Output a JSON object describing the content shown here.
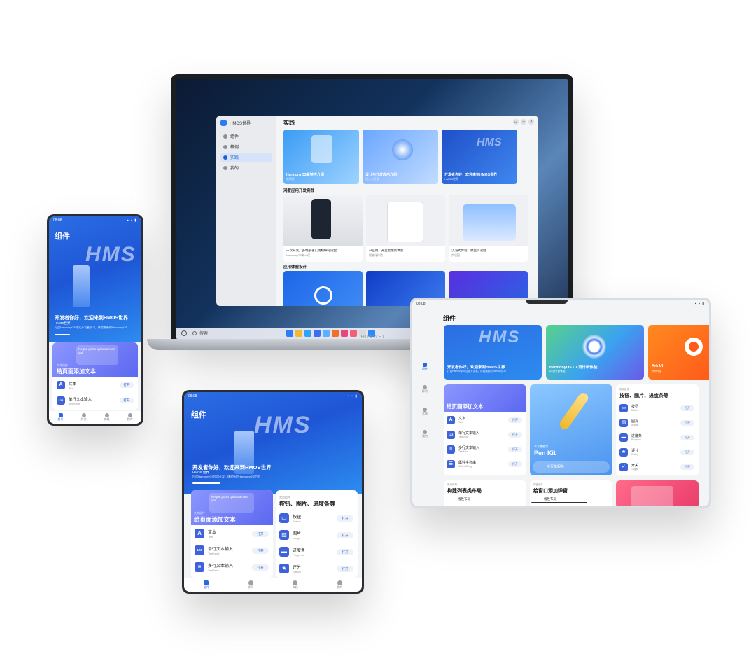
{
  "laptop": {
    "brand": "HUAWEI",
    "window": {
      "app_name": "HMOS世界",
      "nav": [
        {
          "label": "组件",
          "active": false
        },
        {
          "label": "样例",
          "active": false
        },
        {
          "label": "实践",
          "active": true
        },
        {
          "label": "我的",
          "active": false
        }
      ],
      "title": "实践",
      "controls": [
        "↔",
        "–",
        "×"
      ],
      "hero_cards": [
        {
          "title": "HarmonyOS新特性介绍",
          "subtitle": "新特性",
          "color_a": "#3a9cf5",
          "color_b": "#9fd3ff"
        },
        {
          "title": "设计与开发应用介绍",
          "subtitle": "设计与开发",
          "color_a": "#4b8bf7",
          "color_b": "#a9cbff"
        },
        {
          "title": "开发者你好，欢迎来到HMOS世界",
          "subtitle": "HMOS世界",
          "color_a": "#1f4fc9",
          "color_b": "#3f88f0"
        }
      ],
      "section1": "鸿蒙应用开发实践",
      "practice_cards": [
        {
          "title": "一次开发，多端部署实现精细化适配",
          "sub": "HarmonyOS新一代"
        },
        {
          "title": "AI应用，开启智能新体验",
          "sub": "智能化体验"
        },
        {
          "title": "沉浸式体验，原生实况窗",
          "sub": "实况窗"
        }
      ],
      "section2": "应用体验设计",
      "taskbar_search": "搜索"
    }
  },
  "phone": {
    "time": "08:08",
    "signals": "▪ ▪ ▮",
    "page_title": "组件",
    "hero_title": "开发者你好，欢迎来到HMOS世界",
    "hero_sub": "HMOS世界",
    "hero_desc": "打造HarmonyOS样式开发者学习，体验最新的HarmonyOS",
    "hms": "HMS",
    "card_tag": "文本组件",
    "card_title": "给页面添加文本",
    "card_lorem": "Neque porro quisquam est qui",
    "items": [
      {
        "icon": "A",
        "name": "文本",
        "en": "Text",
        "btn": "打开"
      },
      {
        "icon": "123",
        "name": "单行文本输入",
        "en": "TextInput",
        "btn": "打开"
      }
    ],
    "nav": [
      "组件",
      "样例",
      "实践",
      "我的"
    ]
  },
  "foldable": {
    "time": "08:08",
    "page_title": "组件",
    "hero_title": "开发者你好，欢迎来到HMOS世界",
    "hero_sub": "HMOS 世界",
    "hero_desc": "打造HarmonyOS应用开发，体验新的HarmonyOS世界",
    "hms": "HMS",
    "left_card": {
      "tag": "文本组件",
      "title": "给页面添加文本",
      "lorem": "Neque porro quisquam est qui",
      "items": [
        {
          "icon": "A",
          "name": "文本",
          "en": "Text",
          "btn": "打开"
        },
        {
          "icon": "123",
          "name": "单行文本输入",
          "en": "TextInput",
          "btn": "打开"
        },
        {
          "icon": "≡",
          "name": "多行文本输入",
          "en": "TextArea",
          "btn": "打开"
        }
      ]
    },
    "right_card": {
      "tag": "常用组件",
      "title": "按钮、图片、进度条等",
      "items": [
        {
          "icon": "▭",
          "name": "按钮",
          "en": "Button",
          "btn": "打开"
        },
        {
          "icon": "▨",
          "name": "图片",
          "en": "Image",
          "btn": "打开"
        },
        {
          "icon": "▬",
          "name": "进度条",
          "en": "Progress",
          "btn": "打开"
        },
        {
          "icon": "★",
          "name": "评分",
          "en": "Rating",
          "btn": "打开"
        }
      ]
    },
    "nav": [
      "组件",
      "样例",
      "实践",
      "我的"
    ]
  },
  "tablet": {
    "time": "08:08",
    "page_title": "组件",
    "side_nav": [
      "组件",
      "样例",
      "实践",
      "我的"
    ],
    "banners": [
      {
        "title": "开发者你好，欢迎来到HMOS世界",
        "sub": "打造HarmonyOS应用开发者，体验最新的HarmonyOS"
      },
      {
        "title": "HarmonyOS UX设计新体验",
        "sub": "UX设计新体验"
      },
      {
        "title": "Ark UI",
        "sub": "方舟开发"
      }
    ],
    "text_card": {
      "title": "给页面添加文本",
      "items": [
        {
          "icon": "A",
          "name": "文本",
          "en": "Text",
          "btn": "打开"
        },
        {
          "icon": "123",
          "name": "单行文本输入",
          "en": "TextInput",
          "btn": "打开"
        },
        {
          "icon": "≡",
          "name": "多行文本输入",
          "en": "TextArea",
          "btn": "打开"
        },
        {
          "icon": "☰",
          "name": "属性字符串",
          "en": "StyledString",
          "btn": "打开"
        }
      ]
    },
    "pen_card": {
      "tag": "手写笔能力",
      "title": "Pen Kit",
      "button": "手写笔服务"
    },
    "btn_card": {
      "tag": "常用组件",
      "title": "按钮、图片、进度条等",
      "items": [
        {
          "icon": "▭",
          "name": "按钮",
          "en": "Button",
          "btn": "打开"
        },
        {
          "icon": "▨",
          "name": "图片",
          "en": "Image",
          "btn": "打开"
        },
        {
          "icon": "▬",
          "name": "进度条",
          "en": "Progress",
          "btn": "打开"
        },
        {
          "icon": "★",
          "name": "评分",
          "en": "Rating",
          "btn": "打开"
        },
        {
          "icon": "✓",
          "name": "开关",
          "en": "Toggle",
          "btn": "打开"
        }
      ]
    },
    "bottom_cards": [
      {
        "tag": "常用布局",
        "title": "构建列表类布局",
        "item": "线性布局"
      },
      {
        "tag": "弹窗组件",
        "title": "给窗口添加弹窗",
        "item": "线性布局"
      },
      {
        "tag": "",
        "title": "",
        "item": ""
      }
    ]
  }
}
